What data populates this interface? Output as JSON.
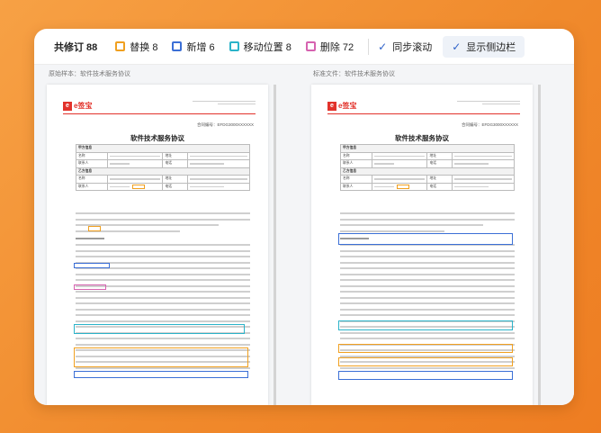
{
  "toolbar": {
    "total": "共修订 88",
    "replace_label": "替换 8",
    "add_label": "新增 6",
    "move_label": "移动位置 8",
    "delete_label": "删除 72",
    "sync_label": "同步滚动",
    "sidebar_label": "显示侧边栏",
    "check_glyph": "✓"
  },
  "colors": {
    "replace": "#f0a020",
    "add": "#3b6fd6",
    "move": "#2bb3c9",
    "delete": "#d663b0",
    "accent": "#2f62c9",
    "background": "#f08a2c"
  },
  "left_pane": {
    "label": "原始样本：软件技术服务协议",
    "doc_title": "软件技术服务协议"
  },
  "right_pane": {
    "label": "标准文件：软件技术服务协议",
    "doc_title": "软件技术服务协议"
  },
  "doc": {
    "logo_text": "e签宝",
    "logo_mark": "e",
    "contract_no": "合同编号：EFDG3000XXXXXX",
    "party_a": "甲方信息",
    "party_b": "乙方信息",
    "name_label": "名称",
    "contact_label": "联系人",
    "address_label": "地址",
    "phone_label": "电话",
    "section_1": "第一条 合同标的"
  }
}
